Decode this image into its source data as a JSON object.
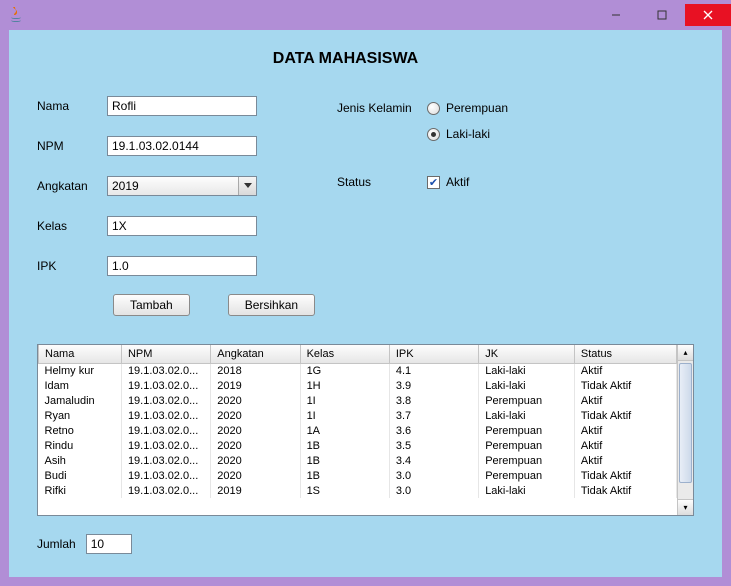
{
  "window": {
    "title": ""
  },
  "heading": "DATA MAHASISWA",
  "form": {
    "labels": {
      "nama": "Nama",
      "npm": "NPM",
      "angkatan": "Angkatan",
      "kelas": "Kelas",
      "ipk": "IPK",
      "jenisKelamin": "Jenis Kelamin",
      "status": "Status",
      "jumlah": "Jumlah"
    },
    "values": {
      "nama": "Rofli",
      "npm": "19.1.03.02.0144",
      "angkatan": "2019",
      "kelas": "1X",
      "ipk": "1.0",
      "jumlah": "10"
    },
    "radios": {
      "perempuan": {
        "label": "Perempuan",
        "selected": false
      },
      "lakiLaki": {
        "label": "Laki-laki",
        "selected": true
      }
    },
    "checkbox": {
      "aktif": {
        "label": "Aktif",
        "checked": true
      }
    }
  },
  "buttons": {
    "tambah": "Tambah",
    "bersihkan": "Bersihkan"
  },
  "table": {
    "headers": [
      "Nama",
      "NPM",
      "Angkatan",
      "Kelas",
      "IPK",
      "JK",
      "Status"
    ],
    "rows": [
      [
        "Helmy kur",
        "19.1.03.02.0...",
        "2018",
        "1G",
        "4.1",
        "Laki-laki",
        "Aktif"
      ],
      [
        "Idam",
        "19.1.03.02.0...",
        "2019",
        "1H",
        "3.9",
        "Laki-laki",
        "Tidak Aktif"
      ],
      [
        "Jamaludin",
        "19.1.03.02.0...",
        "2020",
        "1I",
        "3.8",
        "Perempuan",
        "Aktif"
      ],
      [
        "Ryan",
        "19.1.03.02.0...",
        "2020",
        "1I",
        "3.7",
        "Laki-laki",
        "Tidak Aktif"
      ],
      [
        "Retno",
        "19.1.03.02.0...",
        "2020",
        "1A",
        "3.6",
        "Perempuan",
        "Aktif"
      ],
      [
        "Rindu",
        "19.1.03.02.0...",
        "2020",
        "1B",
        "3.5",
        "Perempuan",
        "Aktif"
      ],
      [
        "Asih",
        "19.1.03.02.0...",
        "2020",
        "1B",
        "3.4",
        "Perempuan",
        "Aktif"
      ],
      [
        "Budi",
        "19.1.03.02.0...",
        "2020",
        "1B",
        "3.0",
        "Perempuan",
        "Tidak Aktif"
      ],
      [
        "Rifki",
        "19.1.03.02.0...",
        "2019",
        "1S",
        "3.0",
        "Laki-laki",
        "Tidak Aktif"
      ]
    ]
  }
}
